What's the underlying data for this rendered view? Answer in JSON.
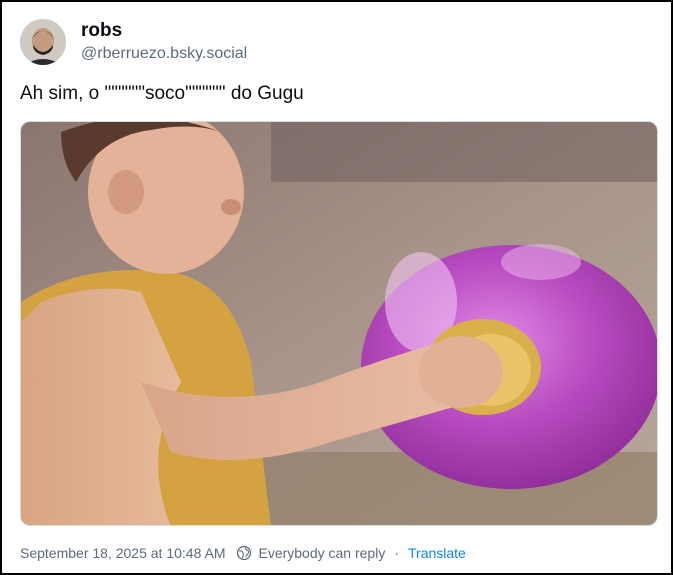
{
  "author": {
    "display_name": "robs",
    "handle": "@rberruezo.bsky.social",
    "avatar_icon": "avatar-photo"
  },
  "post": {
    "text": "Ah sim, o \"\"\"\"\"\"soco\"\"\"\"\"\" do Gugu",
    "media_description_icon": "gif-image"
  },
  "footer": {
    "timestamp": "September 18, 2025 at 10:48 AM",
    "reply_setting": "Everybody can reply",
    "separator": "·",
    "translate_label": "Translate",
    "reply_icon": "globe-icon"
  },
  "colors": {
    "text": "#0b0f14",
    "muted": "#5b6b7a",
    "link": "#1083fe",
    "border": "#000000"
  }
}
